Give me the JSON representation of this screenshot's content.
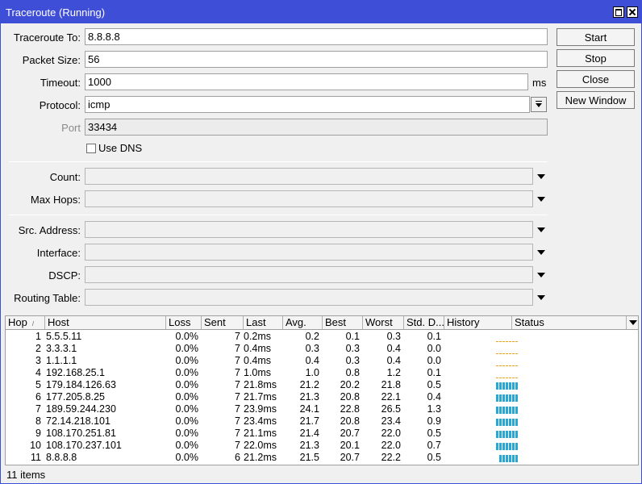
{
  "window": {
    "title": "Traceroute (Running)"
  },
  "form": {
    "traceroute_to_label": "Traceroute To:",
    "traceroute_to_value": "8.8.8.8",
    "packet_size_label": "Packet Size:",
    "packet_size_value": "56",
    "timeout_label": "Timeout:",
    "timeout_value": "1000",
    "timeout_unit": "ms",
    "protocol_label": "Protocol:",
    "protocol_value": "icmp",
    "port_label": "Port",
    "port_value": "33434",
    "use_dns_label": "Use DNS",
    "use_dns_checked": false,
    "count_label": "Count:",
    "max_hops_label": "Max Hops:",
    "src_address_label": "Src. Address:",
    "interface_label": "Interface:",
    "dscp_label": "DSCP:",
    "routing_table_label": "Routing Table:"
  },
  "buttons": {
    "start": "Start",
    "stop": "Stop",
    "close": "Close",
    "new_window": "New Window"
  },
  "table": {
    "columns": [
      "Hop",
      "Host",
      "Loss",
      "Sent",
      "Last",
      "Avg.",
      "Best",
      "Worst",
      "Std. D...",
      "History",
      "Status"
    ],
    "rows": [
      {
        "hop": "1",
        "host": "5.5.5.11",
        "loss": "0.0%",
        "sent": "7",
        "last": "0.2ms",
        "avg": "0.2",
        "best": "0.1",
        "worst": "0.3",
        "std": "0.1",
        "history": [
          1,
          1,
          1,
          1,
          1,
          1,
          1
        ]
      },
      {
        "hop": "2",
        "host": "3.3.3.1",
        "loss": "0.0%",
        "sent": "7",
        "last": "0.4ms",
        "avg": "0.3",
        "best": "0.3",
        "worst": "0.4",
        "std": "0.0",
        "history": [
          1,
          1,
          1,
          1,
          1,
          1,
          1
        ]
      },
      {
        "hop": "3",
        "host": "1.1.1.1",
        "loss": "0.0%",
        "sent": "7",
        "last": "0.4ms",
        "avg": "0.4",
        "best": "0.3",
        "worst": "0.4",
        "std": "0.0",
        "history": [
          1,
          1,
          1,
          1,
          1,
          1,
          1
        ]
      },
      {
        "hop": "4",
        "host": "192.168.25.1",
        "loss": "0.0%",
        "sent": "7",
        "last": "1.0ms",
        "avg": "1.0",
        "best": "0.8",
        "worst": "1.2",
        "std": "0.1",
        "history": [
          1,
          1,
          1,
          1,
          1,
          1,
          1
        ]
      },
      {
        "hop": "5",
        "host": "179.184.126.63",
        "loss": "0.0%",
        "sent": "7",
        "last": "21.8ms",
        "avg": "21.2",
        "best": "20.2",
        "worst": "21.8",
        "std": "0.5",
        "history": [
          21,
          21,
          21,
          21,
          21,
          21,
          22
        ]
      },
      {
        "hop": "6",
        "host": "177.205.8.25",
        "loss": "0.0%",
        "sent": "7",
        "last": "21.7ms",
        "avg": "21.3",
        "best": "20.8",
        "worst": "22.1",
        "std": "0.4",
        "history": [
          21,
          21,
          21,
          21,
          21,
          21,
          22
        ]
      },
      {
        "hop": "7",
        "host": "189.59.244.230",
        "loss": "0.0%",
        "sent": "7",
        "last": "23.9ms",
        "avg": "24.1",
        "best": "22.8",
        "worst": "26.5",
        "std": "1.3",
        "history": [
          23,
          24,
          26,
          24,
          23,
          24,
          24
        ]
      },
      {
        "hop": "8",
        "host": "72.14.218.101",
        "loss": "0.0%",
        "sent": "7",
        "last": "23.4ms",
        "avg": "21.7",
        "best": "20.8",
        "worst": "23.4",
        "std": "0.9",
        "history": [
          21,
          21,
          22,
          21,
          21,
          22,
          23
        ]
      },
      {
        "hop": "9",
        "host": "108.170.251.81",
        "loss": "0.0%",
        "sent": "7",
        "last": "21.1ms",
        "avg": "21.4",
        "best": "20.7",
        "worst": "22.0",
        "std": "0.5",
        "history": [
          21,
          21,
          22,
          21,
          21,
          21,
          21
        ]
      },
      {
        "hop": "10",
        "host": "108.170.237.101",
        "loss": "0.0%",
        "sent": "7",
        "last": "22.0ms",
        "avg": "21.3",
        "best": "20.1",
        "worst": "22.0",
        "std": "0.7",
        "history": [
          21,
          21,
          20,
          21,
          22,
          21,
          22
        ]
      },
      {
        "hop": "11",
        "host": "8.8.8.8",
        "loss": "0.0%",
        "sent": "6",
        "last": "21.2ms",
        "avg": "21.5",
        "best": "20.7",
        "worst": "22.2",
        "std": "0.5",
        "history": [
          21,
          22,
          21,
          21,
          21,
          21
        ]
      }
    ],
    "history_colors": {
      "low": "#e8a317",
      "high": "#2aa8d4"
    }
  },
  "footer": {
    "item_count": "11 items"
  }
}
